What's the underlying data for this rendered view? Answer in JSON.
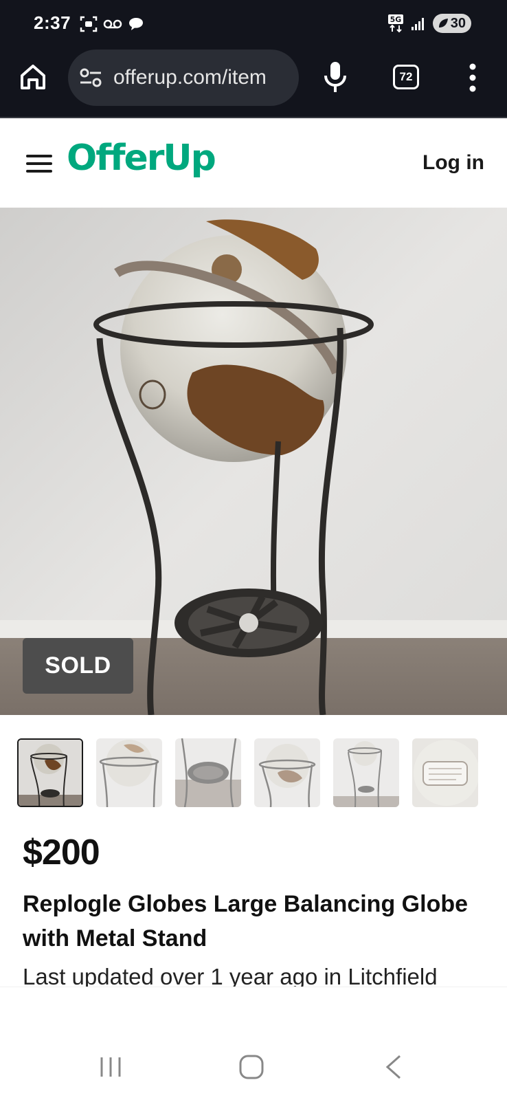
{
  "status_bar": {
    "time": "2:37",
    "network": "5G",
    "battery": "30"
  },
  "browser": {
    "url": "offerup.com/item",
    "tab_count": "72"
  },
  "header": {
    "logo": "OfferUp",
    "login_label": "Log in"
  },
  "listing": {
    "badge": "SOLD",
    "price": "$200",
    "title": "Replogle Globes Large Balancing Globe with Metal Stand",
    "updated": "Last updated over 1 year ago in Litchfield",
    "thumbnail_count": 6,
    "selected_thumbnail": 1
  },
  "colors": {
    "brand": "#00a87e",
    "status_bar_bg": "#12141c",
    "badge_bg": "#4d4d4d"
  }
}
